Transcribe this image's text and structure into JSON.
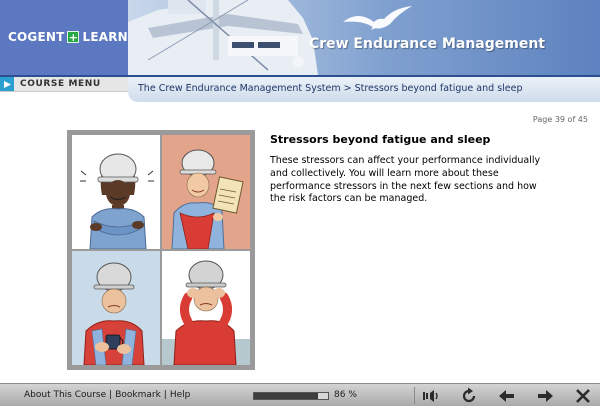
{
  "header": {
    "logo": {
      "left": "COGENT",
      "plus": "+",
      "right": "LEARNING"
    },
    "course_title": "Crew Endurance Management"
  },
  "nav": {
    "course_menu_label": "COURSE MENU",
    "breadcrumb": "The Crew Endurance Management System > Stressors beyond fatigue and sleep"
  },
  "page": {
    "page_number": "Page 39 of 45",
    "title": "Stressors beyond fatigue and sleep",
    "body": "These stressors can affect your performance individually and collectively. You will learn more about these performance stressors in the next few sections and how the risk factors can be managed."
  },
  "illustration": {
    "panels": [
      "cold-worker",
      "worker-with-clipboard",
      "worker-with-coffee",
      "worker-with-headache"
    ]
  },
  "footer": {
    "links": [
      "About This Course",
      "Bookmark",
      "Help"
    ],
    "progress_percent": 86,
    "progress_text": "86 %",
    "buttons": [
      "audio-icon",
      "replay-icon",
      "back-arrow-icon",
      "forward-arrow-icon",
      "close-icon"
    ]
  },
  "colors": {
    "logo_bg": "#5b78c0",
    "accent_green": "#27a844",
    "menu_arrow": "#2a9fd0",
    "breadcrumb_text": "#1f3766"
  }
}
